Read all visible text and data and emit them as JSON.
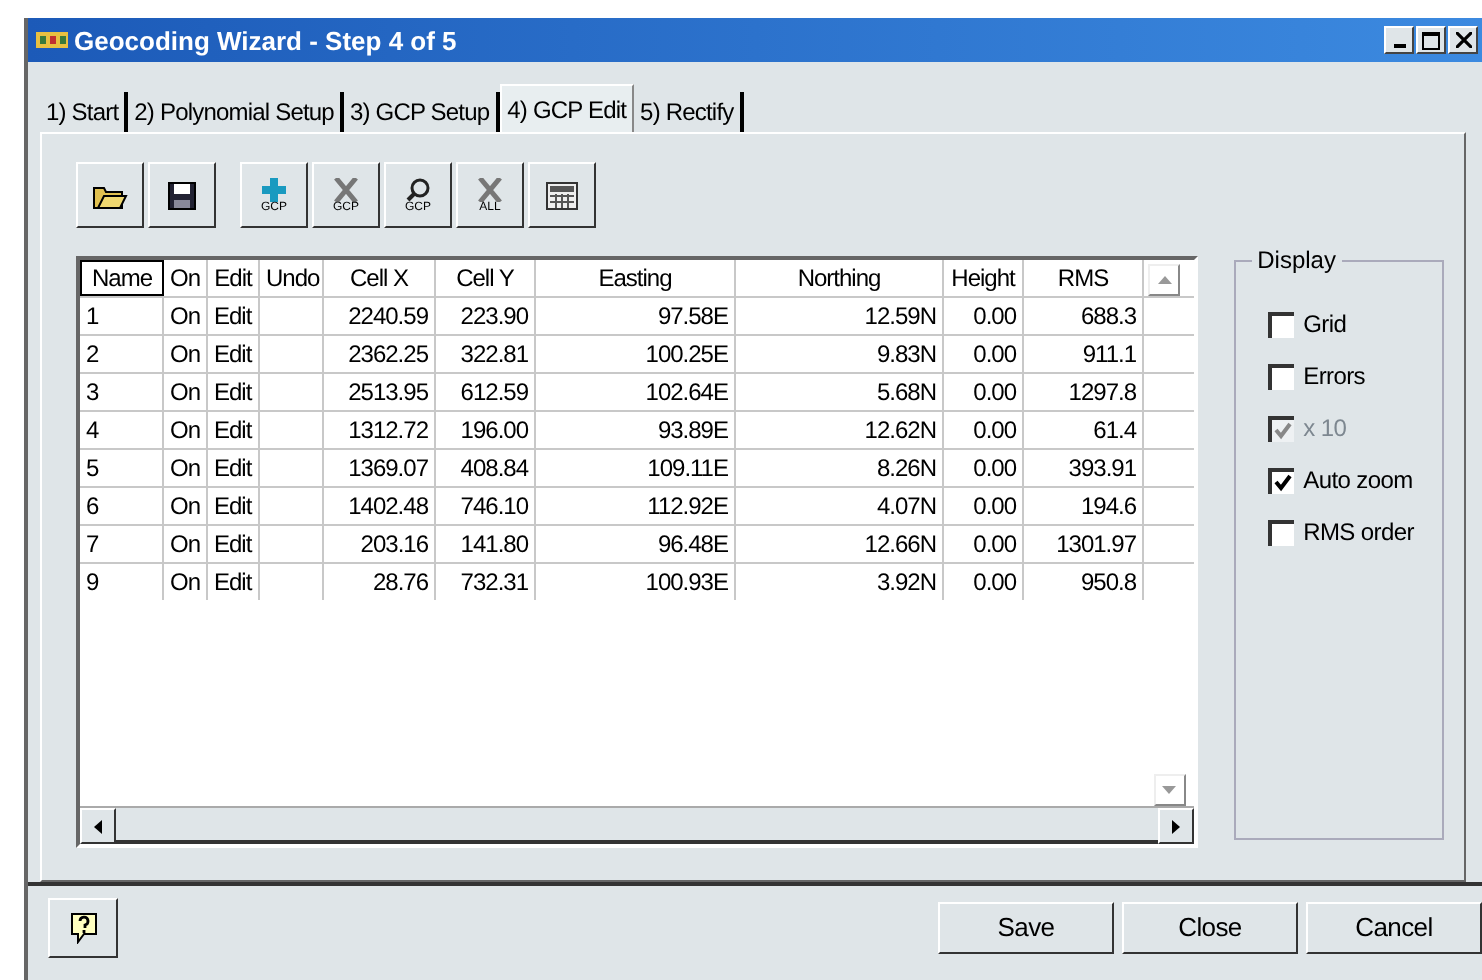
{
  "window": {
    "title": "Geocoding Wizard - Step 4 of 5"
  },
  "tabs": [
    {
      "label": "1) Start",
      "selected": false
    },
    {
      "label": "2) Polynomial Setup",
      "selected": false
    },
    {
      "label": "3) GCP Setup",
      "selected": false
    },
    {
      "label": "4) GCP Edit",
      "selected": true
    },
    {
      "label": "5) Rectify",
      "selected": false
    }
  ],
  "toolbar": [
    {
      "kind": "open"
    },
    {
      "kind": "save"
    },
    {
      "kind": "add",
      "label": "GCP"
    },
    {
      "kind": "delete",
      "label": "GCP"
    },
    {
      "kind": "find",
      "label": "GCP"
    },
    {
      "kind": "delete-all",
      "label": "ALL"
    },
    {
      "kind": "calc"
    }
  ],
  "table": {
    "columns": [
      "Name",
      "On",
      "Edit",
      "Undo",
      "Cell X",
      "Cell Y",
      "Easting",
      "Northing",
      "Height",
      "RMS"
    ],
    "rows": [
      [
        "1",
        "On",
        "Edit",
        "",
        "2240.59",
        "223.90",
        "97.58E",
        "12.59N",
        "0.00",
        "688.3"
      ],
      [
        "2",
        "On",
        "Edit",
        "",
        "2362.25",
        "322.81",
        "100.25E",
        "9.83N",
        "0.00",
        "911.1"
      ],
      [
        "3",
        "On",
        "Edit",
        "",
        "2513.95",
        "612.59",
        "102.64E",
        "5.68N",
        "0.00",
        "1297.8"
      ],
      [
        "4",
        "On",
        "Edit",
        "",
        "1312.72",
        "196.00",
        "93.89E",
        "12.62N",
        "0.00",
        "61.4"
      ],
      [
        "5",
        "On",
        "Edit",
        "",
        "1369.07",
        "408.84",
        "109.11E",
        "8.26N",
        "0.00",
        "393.91"
      ],
      [
        "6",
        "On",
        "Edit",
        "",
        "1402.48",
        "746.10",
        "112.92E",
        "4.07N",
        "0.00",
        "194.6"
      ],
      [
        "7",
        "On",
        "Edit",
        "",
        "203.16",
        "141.80",
        "96.48E",
        "12.66N",
        "0.00",
        "1301.97"
      ],
      [
        "9",
        "On",
        "Edit",
        "",
        "28.76",
        "732.31",
        "100.93E",
        "3.92N",
        "0.00",
        "950.8"
      ]
    ]
  },
  "display": {
    "title": "Display",
    "options": [
      {
        "label": "Grid",
        "checked": false,
        "disabled": false
      },
      {
        "label": "Errors",
        "checked": false,
        "disabled": false
      },
      {
        "label": "x 10",
        "checked": true,
        "disabled": true
      },
      {
        "label": "Auto zoom",
        "checked": true,
        "disabled": false
      },
      {
        "label": "RMS order",
        "checked": false,
        "disabled": false
      }
    ]
  },
  "buttons": [
    "Save",
    "Close",
    "Cancel"
  ]
}
